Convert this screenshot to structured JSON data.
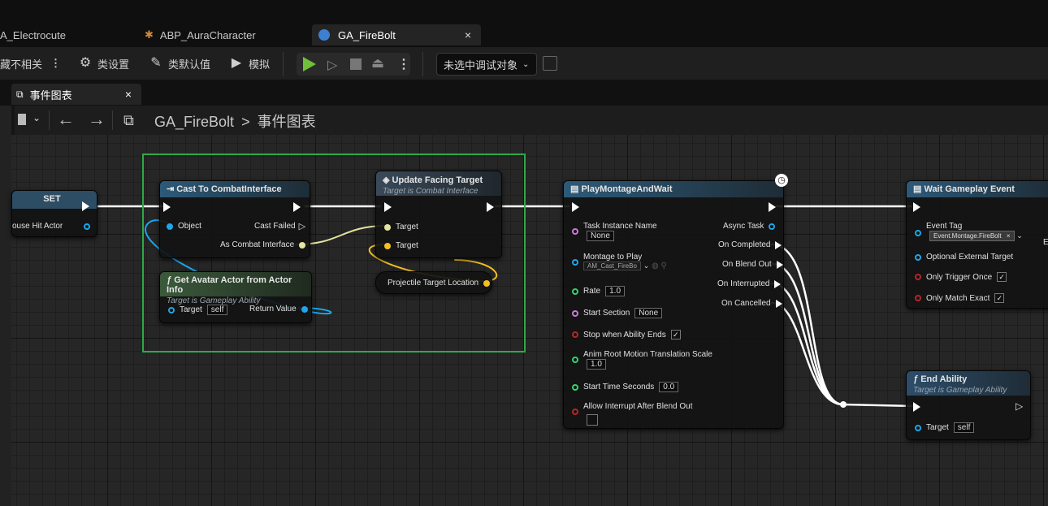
{
  "tabs": [
    {
      "label": "A_Electrocute",
      "active": false
    },
    {
      "label": "ABP_AuraCharacter",
      "active": false
    },
    {
      "label": "GA_FireBolt",
      "active": true
    }
  ],
  "tab_close_glyph": "×",
  "toolbar": {
    "hide_unrelated": "藏不相关",
    "class_settings": "类设置",
    "class_defaults": "类默认值",
    "simulate": "模拟",
    "debug_object": "未选中调试对象"
  },
  "graph_tab": {
    "label": "事件图表"
  },
  "breadcrumb": {
    "root": "GA_FireBolt",
    "separator": ">",
    "current": "事件图表"
  },
  "nodes": {
    "set": {
      "title": "SET",
      "pin": "ouse Hit Actor"
    },
    "cast": {
      "title": "Cast To CombatInterface",
      "object": "Object",
      "cast_failed": "Cast Failed",
      "as_combat": "As Combat Interface"
    },
    "get_avatar": {
      "title": "Get Avatar Actor from Actor Info",
      "subtitle": "Target is Gameplay Ability",
      "target": "Target",
      "target_value": "self",
      "return_value": "Return Value"
    },
    "update_facing": {
      "title": "Update Facing Target",
      "subtitle": "Target is Combat Interface",
      "target1": "Target",
      "target2": "Target"
    },
    "projectile": {
      "title": "Projectile Target Location"
    },
    "play_montage": {
      "title": "PlayMontageAndWait",
      "task_instance_name": "Task Instance Name",
      "task_instance_value": "None",
      "montage_to_play": "Montage to Play",
      "montage_value": "AM_Cast_FireBo",
      "rate": "Rate",
      "rate_value": "1.0",
      "start_section": "Start Section",
      "start_section_value": "None",
      "stop_when_ends": "Stop when Ability Ends",
      "anim_root_motion": "Anim Root Motion Translation Scale",
      "anim_root_value": "1.0",
      "start_time": "Start Time Seconds",
      "start_time_value": "0.0",
      "allow_interrupt": "Allow Interrupt After Blend Out",
      "async_task": "Async Task",
      "on_completed": "On Completed",
      "on_blend_out": "On Blend Out",
      "on_interrupted": "On Interrupted",
      "on_cancelled": "On Cancelled"
    },
    "wait_event": {
      "title": "Wait Gameplay Event",
      "event_tag": "Event Tag",
      "event_tag_value": "Event.Montage.FireBolt",
      "optional_target": "Optional External Target",
      "only_trigger_once": "Only Trigger Once",
      "only_match_exact": "Only Match Exact",
      "edge_label": "E"
    },
    "end_ability": {
      "title": "End Ability",
      "subtitle": "Target is Gameplay Ability",
      "target": "Target",
      "target_value": "self"
    }
  },
  "checkmark": "✓",
  "colors": {
    "selection": "#2fa84a",
    "exec": "#ffffff",
    "object_pin": "#1aa7ec",
    "vector_pin": "#f4c020",
    "bool_pin": "#b4262c",
    "float_pin": "#38d16a",
    "name_pin": "#c77bd6"
  }
}
